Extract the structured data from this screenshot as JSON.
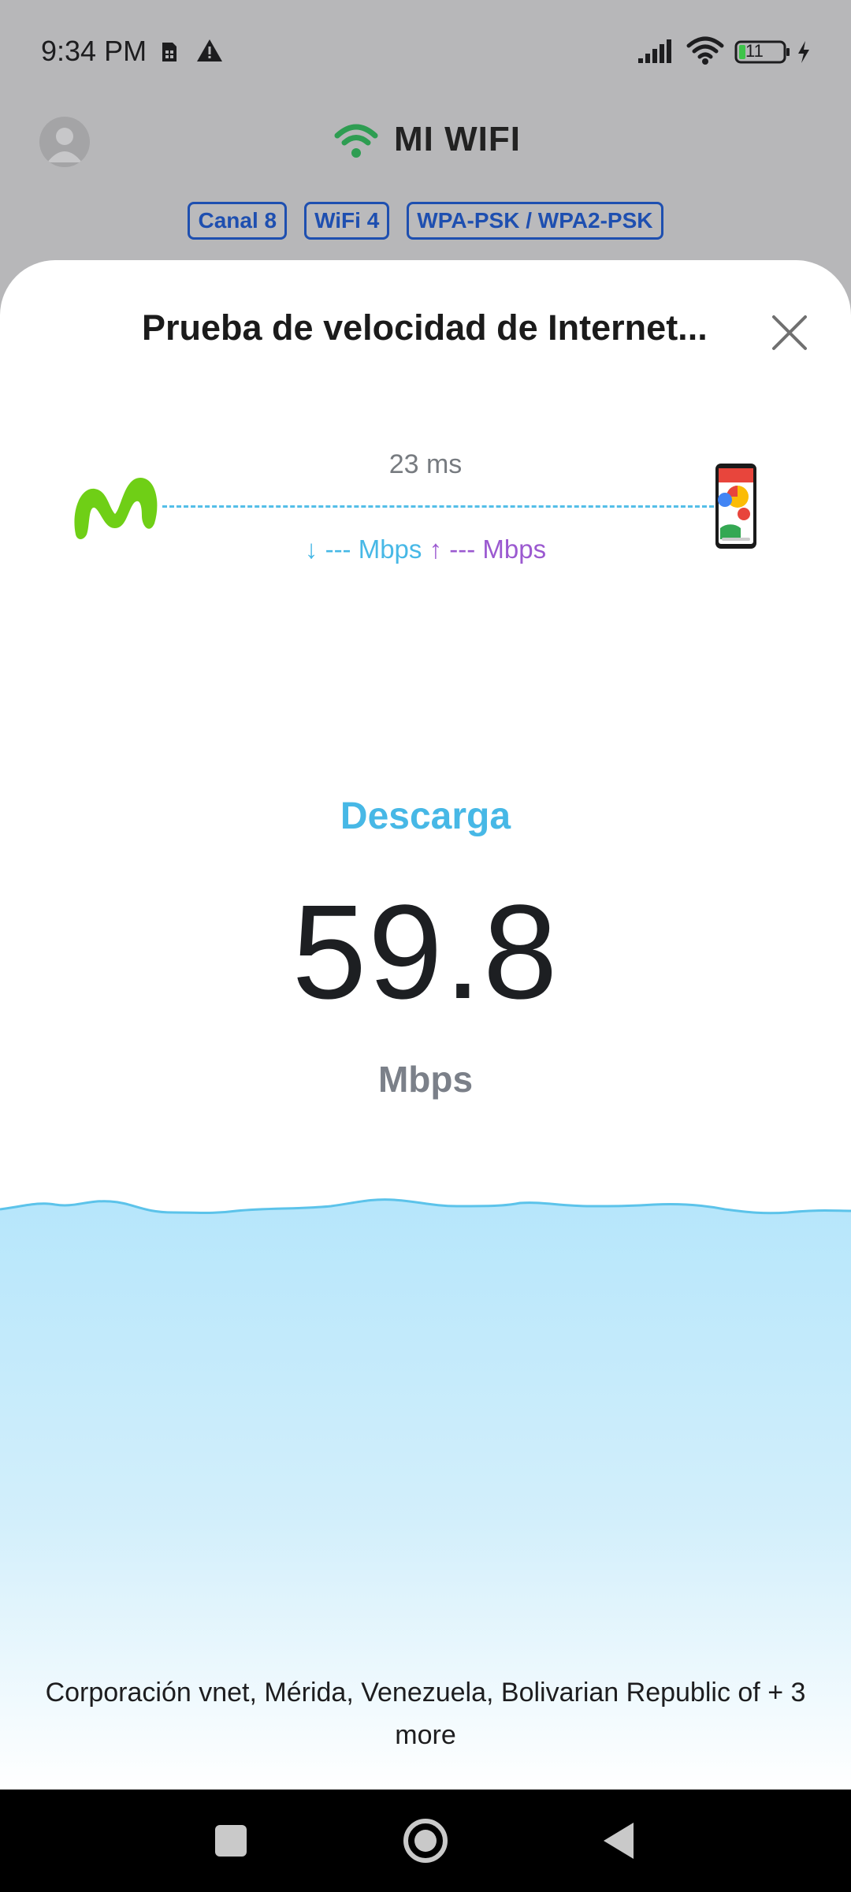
{
  "status_bar": {
    "time": "9:34 PM",
    "battery_level": "11",
    "icons": [
      "sim-card-icon",
      "alert-icon",
      "signal-icon",
      "wifi-icon",
      "battery-icon",
      "charging-icon"
    ]
  },
  "header": {
    "title": "MI WIFI",
    "icon": "wifi-icon",
    "tags": [
      "Canal 8",
      "WiFi 4",
      "WPA-PSK / WPA2-PSK"
    ]
  },
  "sheet": {
    "title": "Prueba de velocidad de Internet...",
    "close_icon": "close-icon",
    "ping": "23 ms",
    "download_placeholder": "↓ --- Mbps",
    "upload_placeholder": "↑ --- Mbps",
    "mode_label": "Descarga",
    "speed_value": "59.8",
    "speed_unit": "Mbps",
    "server_info": "Corporación vnet, Mérida, Venezuela, Bolivarian Republic of + 3 more"
  },
  "colors": {
    "accent_blue": "#47b8e6",
    "upload_purple": "#9b59d0",
    "provider_green": "#6fcf16",
    "tag_blue": "#1e4fb0",
    "wifi_green": "#2e9d52"
  },
  "nav_bar": {
    "buttons": [
      "recents-button",
      "home-button",
      "back-button"
    ]
  }
}
